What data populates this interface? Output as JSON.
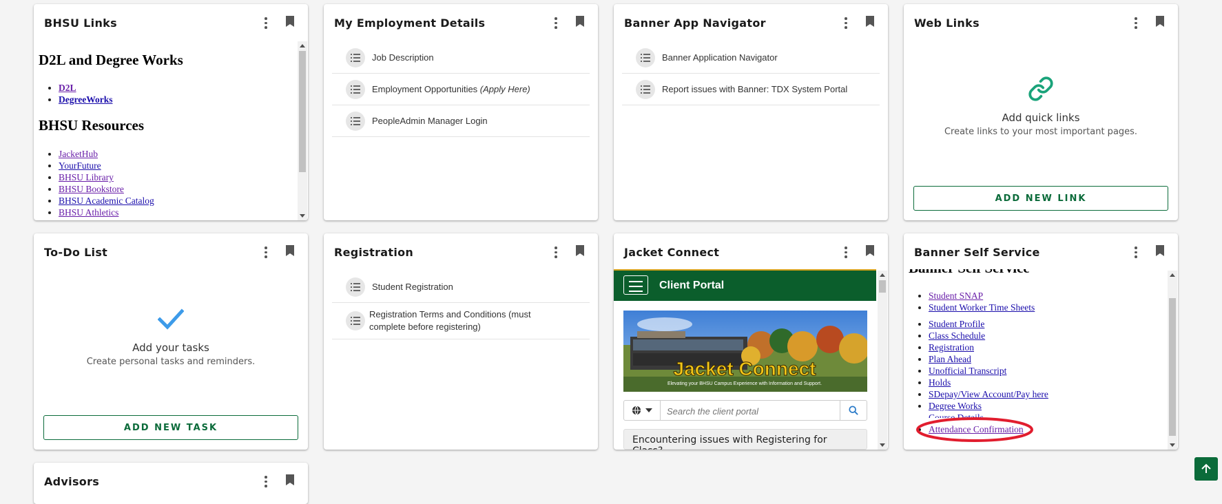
{
  "cards": {
    "bhsu_links": {
      "title": "BHSU Links",
      "heading1": "D2L and Degree Works",
      "group1": [
        "D2L",
        "DegreeWorks"
      ],
      "heading2": "BHSU Resources",
      "group2": [
        "JacketHub",
        "YourFuture",
        "BHSU Library",
        "BHSU Bookstore",
        "BHSU Academic Catalog",
        "BHSU Athletics"
      ]
    },
    "employment": {
      "title": "My Employment Details",
      "items": [
        {
          "label": "Job Description",
          "note": ""
        },
        {
          "label": "Employment Opportunities ",
          "note": "(Apply Here)"
        },
        {
          "label": "PeopleAdmin Manager Login",
          "note": ""
        }
      ]
    },
    "banner_nav": {
      "title": "Banner App Navigator",
      "items": [
        "Banner Application Navigator",
        "Report issues with Banner: TDX System Portal"
      ]
    },
    "web_links": {
      "title": "Web Links",
      "empty_title": "Add quick links",
      "empty_sub": "Create links to your most important pages.",
      "button": "ADD NEW LINK"
    },
    "todo": {
      "title": "To-Do List",
      "empty_title": "Add your tasks",
      "empty_sub": "Create personal tasks and reminders.",
      "button": "ADD NEW TASK"
    },
    "registration": {
      "title": "Registration",
      "items": [
        "Student Registration",
        "Registration Terms and Conditions (must complete before registering)"
      ]
    },
    "jacket_connect": {
      "title": "Jacket Connect",
      "portal_title": "Client Portal",
      "banner_text": "Jacket Connect",
      "banner_tagline": "Elevating your BHSU Campus Experience with Information and Support.",
      "search_placeholder": "Search the client portal",
      "message": "Encountering issues with Registering for Class?"
    },
    "banner_ss": {
      "title": "Banner Self Service",
      "cut_heading": "Banner Self Service",
      "group1": [
        "Student SNAP",
        "Student Worker Time Sheets"
      ],
      "group2": [
        "Student Profile",
        "Class Schedule",
        "Registration",
        "Plan Ahead",
        "Unofficial Transcript",
        "Holds",
        "SDepay/View Account/Pay here",
        "Degree Works",
        "Course Details",
        "Attendance Confirmation"
      ]
    },
    "advisors": {
      "title": "Advisors"
    }
  },
  "colors": {
    "accent_green": "#0b6b3a",
    "portal_green": "#0b5e2c",
    "link_blue": "#1a0dab",
    "link_visited": "#681da8",
    "highlight_red": "#e11d2e",
    "check_blue": "#3d9be9"
  },
  "icons": {
    "menu": "kebab-menu-icon",
    "pin": "bookmark-icon",
    "list": "list-icon",
    "link": "link-icon",
    "check": "checkmark-icon",
    "globe": "globe-icon",
    "search": "search-icon",
    "scroll_top": "arrow-up-icon"
  }
}
